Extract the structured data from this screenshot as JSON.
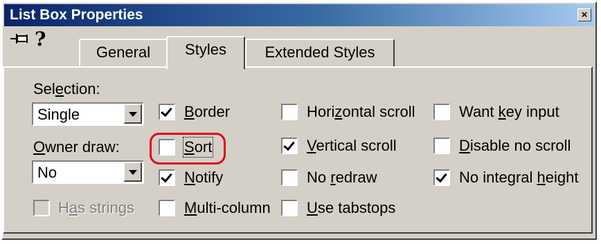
{
  "window": {
    "title": "List Box Properties",
    "close_glyph": "×"
  },
  "icons": {
    "pin": "pushpin-icon",
    "help": "help-icon",
    "help_glyph": "?"
  },
  "tabs": [
    {
      "label": "General",
      "active": false
    },
    {
      "label": "Styles",
      "active": true
    },
    {
      "label": "Extended Styles",
      "active": false
    }
  ],
  "selection": {
    "label_pre": "Sel",
    "label_key": "e",
    "label_post": "ction:",
    "value": "Single"
  },
  "owner_draw": {
    "label_key": "O",
    "label_post": "wner draw:",
    "value": "No"
  },
  "has_strings": {
    "pre": "H",
    "key": "a",
    "post": "s strings",
    "checked": false,
    "enabled": false
  },
  "options": {
    "border": {
      "key": "B",
      "post": "order",
      "checked": true
    },
    "sort": {
      "key": "S",
      "post": "ort",
      "checked": false
    },
    "notify": {
      "key": "N",
      "post": "otify",
      "checked": true
    },
    "multi_column": {
      "key": "M",
      "post": "ulti-column",
      "checked": false
    },
    "horizontal_scroll": {
      "pre": "Hori",
      "key": "z",
      "post": "ontal scroll",
      "checked": false
    },
    "vertical_scroll": {
      "key": "V",
      "post": "ertical scroll",
      "checked": true
    },
    "no_redraw": {
      "pre": "No ",
      "key": "r",
      "post": "edraw",
      "checked": false
    },
    "use_tabstops": {
      "key": "U",
      "post": "se tabstops",
      "checked": false
    },
    "want_key_input": {
      "pre": "Want ",
      "key": "k",
      "post": "ey input",
      "checked": false
    },
    "disable_no_scroll": {
      "key": "D",
      "post": "isable no scroll",
      "checked": false
    },
    "no_integral_height": {
      "pre": "No integral ",
      "key": "h",
      "post": "eight",
      "checked": true
    }
  },
  "colors": {
    "face": "#d4d0c8",
    "title_start": "#0a246a",
    "title_end": "#a6caf0",
    "highlight": "#e3001b"
  }
}
